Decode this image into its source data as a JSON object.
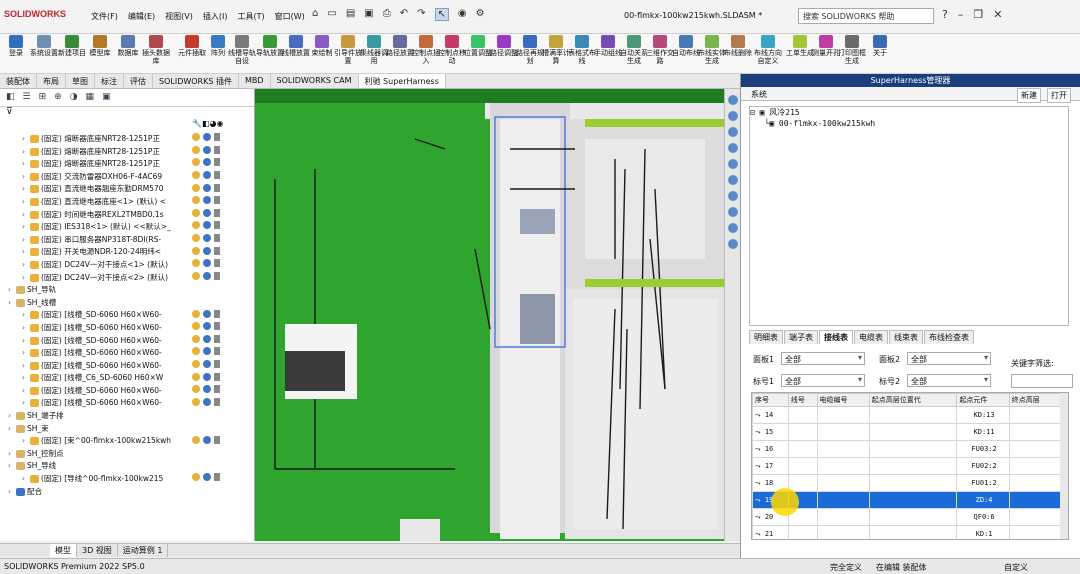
{
  "app": {
    "logo": "SOLIDWORKS",
    "doc_title": "00-flmkx-100kw215kwh.SLDASM *",
    "search_placeholder": "搜索 SOLIDWORKS 帮助"
  },
  "menu": [
    "文件(F)",
    "编辑(E)",
    "视图(V)",
    "插入(I)",
    "工具(T)",
    "窗口(W)"
  ],
  "ribbon": [
    {
      "label": "登录",
      "color": "#2f6fbf"
    },
    {
      "label": "系统设置",
      "color": "#6f8fb0"
    },
    {
      "label": "新建项目",
      "color": "#3a8a3a"
    },
    {
      "label": "模型库",
      "color": "#b07a2a"
    },
    {
      "label": "数据库",
      "color": "#5a7ab0"
    },
    {
      "label": "插头数据库",
      "color": "#b04a4a"
    },
    {
      "label": "元件插取",
      "color": "#c23b2b"
    },
    {
      "label": "阵列",
      "color": "#3a7ac4"
    },
    {
      "label": "线槽导轨自设",
      "color": "#7a7a7a"
    },
    {
      "label": "导轨放置",
      "color": "#3a9a3a"
    },
    {
      "label": "线槽放置",
      "color": "#4a6ac4"
    },
    {
      "label": "束绘制",
      "color": "#8a5ac4"
    },
    {
      "label": "引导件放置",
      "color": "#c49a3a"
    },
    {
      "label": "集线器调用",
      "color": "#3a9aa4"
    },
    {
      "label": "路径放置",
      "color": "#6a6a9a"
    },
    {
      "label": "控制点插入",
      "color": "#c46a3a"
    },
    {
      "label": "控制点移动",
      "color": "#c43a6a"
    },
    {
      "label": "位置调整",
      "color": "#3ac46a"
    },
    {
      "label": "路径调整",
      "color": "#9a3ac4"
    },
    {
      "label": "路径再规划",
      "color": "#3a6ac4"
    },
    {
      "label": "槽满率计算",
      "color": "#c4a43a"
    },
    {
      "label": "表格式布线",
      "color": "#3a8ab4"
    },
    {
      "label": "手动组线",
      "color": "#7a4ab4"
    },
    {
      "label": "自动关系生成",
      "color": "#4a9a7a"
    },
    {
      "label": "三维作交路",
      "color": "#b44a7a"
    },
    {
      "label": "自动布线",
      "color": "#4a7ab4"
    },
    {
      "label": "布线实体生成",
      "color": "#7ab44a"
    },
    {
      "label": "布线删除",
      "color": "#b47a4a"
    },
    {
      "label": "布线方向自定义",
      "color": "#3aa4c4"
    },
    {
      "label": "工单生成",
      "color": "#a4c43a"
    },
    {
      "label": "测量开孔",
      "color": "#c43aa4"
    },
    {
      "label": "打印图框生成",
      "color": "#6a6a6a"
    },
    {
      "label": "关于",
      "color": "#3a6ab4"
    }
  ],
  "tabs": [
    "装配体",
    "布局",
    "草图",
    "标注",
    "评估",
    "SOLIDWORKS 插件",
    "MBD",
    "SOLIDWORKS CAM",
    "利驰 SuperHarness"
  ],
  "tree": [
    {
      "t": "(固定) 熔断器底座NRT28-1251P正",
      "k": "part",
      "lvl": 1
    },
    {
      "t": "(固定) 熔断器底座NRT28-1251P正",
      "k": "part",
      "lvl": 1
    },
    {
      "t": "(固定) 熔断器底座NRT28-1251P正",
      "k": "part",
      "lvl": 1
    },
    {
      "t": "(固定) 交流防雷器DXH06-F-4AC69",
      "k": "part",
      "lvl": 1
    },
    {
      "t": "(固定) 直流继电器翘座东勤DRM570",
      "k": "part",
      "lvl": 1
    },
    {
      "t": "(固定) 直流继电器底座<1> (默认) <",
      "k": "part",
      "lvl": 1
    },
    {
      "t": "(固定) 时间继电器REXL2TMBD0.1s",
      "k": "part",
      "lvl": 1
    },
    {
      "t": "(固定) IES318<1> (默认) <<默认>_",
      "k": "part",
      "lvl": 1
    },
    {
      "t": "(固定) 串口服务器NP318T-8DI(RS-",
      "k": "part",
      "lvl": 1
    },
    {
      "t": "(固定) 开关电源NDR-120-24明纬<",
      "k": "part",
      "lvl": 1
    },
    {
      "t": "(固定) DC24V一对干接点<1> (默认)",
      "k": "part",
      "lvl": 1
    },
    {
      "t": "(固定) DC24V一对干接点<2> (默认)",
      "k": "part",
      "lvl": 1
    },
    {
      "t": "SH_导轨",
      "k": "fold",
      "lvl": 0
    },
    {
      "t": "SH_线槽",
      "k": "fold",
      "lvl": 0
    },
    {
      "t": "(固定) [线槽_SD-6060 H60×W60-",
      "k": "part",
      "lvl": 1
    },
    {
      "t": "(固定) [线槽_SD-6060 H60×W60-",
      "k": "part",
      "lvl": 1
    },
    {
      "t": "(固定) [线槽_SD-6060 H60×W60-",
      "k": "part",
      "lvl": 1
    },
    {
      "t": "(固定) [线槽_SD-6060 H60×W60-",
      "k": "part",
      "lvl": 1
    },
    {
      "t": "(固定) [线槽_SD-6060 H60×W60-",
      "k": "part",
      "lvl": 1
    },
    {
      "t": "(固定) [线槽_C6_SD-6060 H60×W",
      "k": "part",
      "lvl": 1
    },
    {
      "t": "(固定) [线槽_SD-6060 H60×W60-",
      "k": "part",
      "lvl": 1
    },
    {
      "t": "(固定) [线槽_SD-6060 H60×W60-",
      "k": "part",
      "lvl": 1
    },
    {
      "t": "SH_端子排",
      "k": "fold",
      "lvl": 0
    },
    {
      "t": "SH_束",
      "k": "fold",
      "lvl": 0
    },
    {
      "t": "(固定) [束^00-flmkx-100kw215kwh",
      "k": "part",
      "lvl": 1
    },
    {
      "t": "SH_控制点",
      "k": "fold",
      "lvl": 0
    },
    {
      "t": "SH_导线",
      "k": "fold",
      "lvl": 0
    },
    {
      "t": "(固定) [导线^00-flmkx-100kw215",
      "k": "part",
      "lvl": 1
    },
    {
      "t": "配合",
      "k": "sym",
      "lvl": 0
    }
  ],
  "bottom_tabs": [
    "模型",
    "3D 视图",
    "运动算例 1"
  ],
  "status": {
    "left": "SOLIDWORKS Premium 2022 SP5.0",
    "s1": "完全定义",
    "s2": "在编辑 装配体",
    "s3": "自定义"
  },
  "panel": {
    "title": "SuperHarness管理器",
    "tab": "系统",
    "btn_new": "新建",
    "btn_open": "打开",
    "tree": [
      "风冷215",
      "00-flmkx-100kw215kwh"
    ],
    "subtabs": [
      "明细表",
      "端子表",
      "接线表",
      "电缆表",
      "线束表",
      "布线检查表"
    ],
    "active_subtab": "接线表",
    "filters": {
      "panel1_label": "面板1",
      "panel2_label": "面板2",
      "tag1_label": "标号1",
      "tag2_label": "标号2",
      "all": "全部",
      "keyword_label": "关键字筛选:"
    },
    "columns": [
      "序号",
      "线号",
      "电缆编号",
      "起点高层位置代",
      "起点元件",
      "终点高层"
    ],
    "rows": [
      {
        "no": "14",
        "end": "KD:13"
      },
      {
        "no": "15",
        "end": "KD:11"
      },
      {
        "no": "16",
        "end": "FU03:2"
      },
      {
        "no": "17",
        "end": "FU02:2"
      },
      {
        "no": "18",
        "end": "FU01:2"
      },
      {
        "no": "19",
        "end": "ZD:4"
      },
      {
        "no": "20",
        "end": "QF0:6"
      },
      {
        "no": "21",
        "end": "KD:1"
      }
    ],
    "selected_row": "19"
  }
}
